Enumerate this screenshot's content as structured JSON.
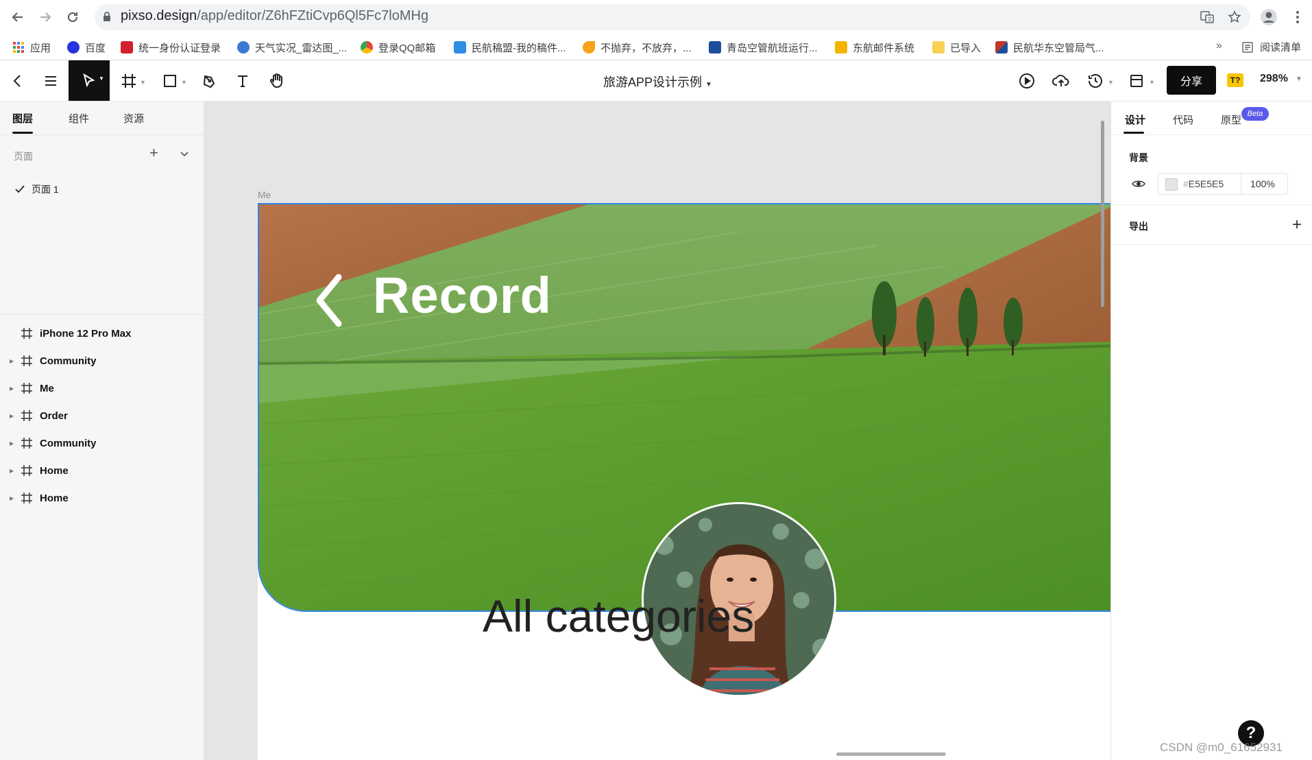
{
  "browser": {
    "url_host": "pixso.design",
    "url_path": "/app/editor/Z6hFZtiCvp6Ql5Fc7loMHg",
    "bookmarks": [
      {
        "label": "应用",
        "color": "#e8453c"
      },
      {
        "label": "百度",
        "color": "#2932e1"
      },
      {
        "label": "统一身份认证登录",
        "color": "#d0202b"
      },
      {
        "label": "天气实况_雷达图_...",
        "color": "#3b7bd4"
      },
      {
        "label": "登录QQ邮箱",
        "color": "#f5a623"
      },
      {
        "label": "民航稿盟-我的稿件...",
        "color": "#2d8ee6"
      },
      {
        "label": "不抛弃，不放弃，...",
        "color": "#f7a21b"
      },
      {
        "label": "青岛空管航班运行...",
        "color": "#1d4e9c"
      },
      {
        "label": "东航邮件系统",
        "color": "#f4b400"
      },
      {
        "label": "已导入",
        "color": "#f7d154"
      },
      {
        "label": "民航华东空管局气...",
        "color": "#c0392b"
      }
    ],
    "bookmarks_more": "»",
    "reading_list": "阅读清单"
  },
  "editor": {
    "doc_title": "旅游APP设计示例",
    "share_label": "分享",
    "font_badge": "T?",
    "zoom": "298%"
  },
  "left_panel": {
    "tabs": [
      "图层",
      "组件",
      "资源"
    ],
    "pages_label": "页面",
    "current_page": "页面 1",
    "layers": [
      {
        "name": "iPhone 12 Pro Max",
        "expandable": false
      },
      {
        "name": "Community",
        "expandable": true
      },
      {
        "name": "Me",
        "expandable": true
      },
      {
        "name": "Order",
        "expandable": true
      },
      {
        "name": "Community",
        "expandable": true
      },
      {
        "name": "Home",
        "expandable": true
      },
      {
        "name": "Home",
        "expandable": true
      }
    ]
  },
  "canvas": {
    "frame_label": "Me",
    "hero_title": "Record",
    "section_heading": "All categories",
    "background_color": "#e5e5e5",
    "selection_color": "#2f86eb"
  },
  "right_panel": {
    "tabs": [
      "设计",
      "代码",
      "原型"
    ],
    "beta": "Beta",
    "background_label": "背景",
    "bg_hex": "E5E5E5",
    "bg_opacity": "100%",
    "export_label": "导出"
  },
  "help": "?",
  "watermark": "CSDN @m0_61652931"
}
